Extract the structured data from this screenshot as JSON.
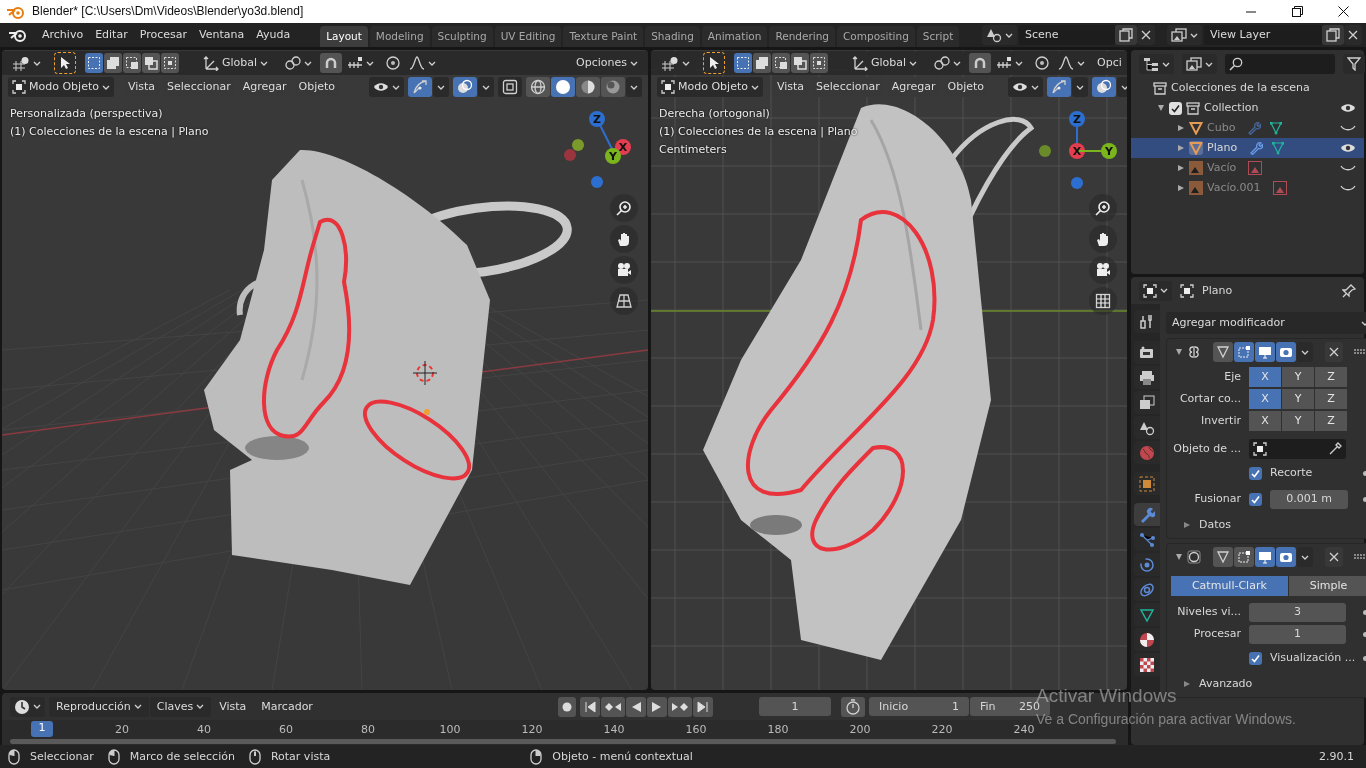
{
  "title_bar": {
    "title": "Blender* [C:\\Users\\Dm\\Videos\\Blender\\yo3d.blend]"
  },
  "menu": [
    "Archivo",
    "Editar",
    "Procesar",
    "Ventana",
    "Ayuda"
  ],
  "workspace_tabs": [
    {
      "label": "Layout",
      "selected": true
    },
    {
      "label": "Modeling",
      "selected": false
    },
    {
      "label": "Sculpting",
      "selected": false
    },
    {
      "label": "UV Editing",
      "selected": false
    },
    {
      "label": "Texture Paint",
      "selected": false
    },
    {
      "label": "Shading",
      "selected": false
    },
    {
      "label": "Animation",
      "selected": false
    },
    {
      "label": "Rendering",
      "selected": false
    },
    {
      "label": "Compositing",
      "selected": false
    },
    {
      "label": "Script",
      "selected": false
    }
  ],
  "scene": "Scene",
  "view_layer": "View Layer",
  "viewports": [
    {
      "kind": "perspective",
      "orientation": "Global",
      "options": "Opciones",
      "mode": "Modo Objeto",
      "menus": [
        "Vista",
        "Seleccionar",
        "Agregar",
        "Objeto"
      ],
      "select_modes": [
        {
          "kind": "set",
          "selected": true
        },
        {
          "kind": "extend",
          "selected": false
        },
        {
          "kind": "subtract",
          "selected": false
        },
        {
          "kind": "invert",
          "selected": false
        },
        {
          "kind": "intersect",
          "selected": false
        }
      ],
      "gizmos_on": true,
      "overlays_on": true,
      "shading": [
        {
          "kind": "wireframe",
          "selected": false
        },
        {
          "kind": "solid",
          "selected": true
        },
        {
          "kind": "material",
          "selected": false
        },
        {
          "kind": "rendered",
          "selected": false
        }
      ],
      "overlay_text": [
        "Personalizada (perspectiva)",
        "(1) Colecciones de la escena | Plano"
      ],
      "gizmo": [
        "Z",
        "X",
        "Y"
      ]
    },
    {
      "kind": "side",
      "orientation": "Global",
      "options": "Opci",
      "mode": "Modo Objeto",
      "menus": [
        "Vista",
        "Seleccionar",
        "Agregar",
        "Objeto"
      ],
      "select_modes": [
        {
          "kind": "set",
          "selected": true
        },
        {
          "kind": "extend",
          "selected": false
        },
        {
          "kind": "subtract",
          "selected": false
        },
        {
          "kind": "invert",
          "selected": false
        },
        {
          "kind": "intersect",
          "selected": false
        }
      ],
      "gizmos_on": true,
      "overlays_on": true,
      "overlay_text": [
        "Derecha (ortogonal)",
        "(1) Colecciones de la escena | Plano",
        "Centimeters"
      ],
      "gizmo": [
        "Z",
        "X",
        "Y"
      ]
    }
  ],
  "outliner": {
    "root": "Colecciones de la escena",
    "items": [
      {
        "label": "Collection",
        "kind": "collection",
        "expanded": true,
        "checked": true,
        "visible": true,
        "selected": false,
        "children": [
          {
            "label": "Cubo",
            "kind": "mesh",
            "expanded": false,
            "visible": false,
            "selected": false
          },
          {
            "label": "Plano",
            "kind": "mesh",
            "expanded": false,
            "visible": true,
            "selected": true
          },
          {
            "label": "Vacío",
            "kind": "empty",
            "expanded": false,
            "visible": false,
            "selected": false
          },
          {
            "label": "Vacío.001",
            "kind": "empty",
            "expanded": false,
            "visible": false,
            "selected": false
          }
        ]
      }
    ]
  },
  "properties": {
    "object": "Plano",
    "tabs": [
      {
        "kind": "tool",
        "selected": false
      },
      {
        "kind": "render",
        "selected": false
      },
      {
        "kind": "output",
        "selected": false
      },
      {
        "kind": "view_layer",
        "selected": false
      },
      {
        "kind": "scene",
        "selected": false
      },
      {
        "kind": "world",
        "selected": false
      },
      {
        "kind": "object",
        "selected": false
      },
      {
        "kind": "modifiers",
        "selected": true
      },
      {
        "kind": "particles",
        "selected": false
      },
      {
        "kind": "physics",
        "selected": false
      },
      {
        "kind": "constraints",
        "selected": false
      },
      {
        "kind": "data",
        "selected": false
      },
      {
        "kind": "material",
        "selected": false
      },
      {
        "kind": "texture",
        "selected": false
      }
    ],
    "add_modifier": "Agregar modificador",
    "modifiers": [
      {
        "kind": "mirror",
        "expanded": true,
        "toggles": [
          {
            "kind": "cage",
            "on": false
          },
          {
            "kind": "edit",
            "on": true
          },
          {
            "kind": "viewport",
            "on": true
          },
          {
            "kind": "render",
            "on": true
          }
        ],
        "rows": [
          {
            "kind": "axes",
            "label": "Eje",
            "buttons": [
              {
                "label": "X",
                "selected": true
              },
              {
                "label": "Y",
                "selected": false
              },
              {
                "label": "Z",
                "selected": false
              }
            ]
          },
          {
            "kind": "axes",
            "label": "Cortar co...",
            "buttons": [
              {
                "label": "X",
                "selected": true
              },
              {
                "label": "Y",
                "selected": false
              },
              {
                "label": "Z",
                "selected": false
              }
            ]
          },
          {
            "kind": "axes",
            "label": "Invertir",
            "buttons": [
              {
                "label": "X",
                "selected": false
              },
              {
                "label": "Y",
                "selected": false
              },
              {
                "label": "Z",
                "selected": false
              }
            ]
          },
          {
            "kind": "object_field",
            "label": "Objeto de ..."
          },
          {
            "kind": "checkbox",
            "label": "Recorte",
            "checked": true
          },
          {
            "kind": "checkbox_value",
            "label": "Fusionar",
            "checked": true,
            "value": "0.001 m"
          },
          {
            "kind": "subpanel",
            "label": "Datos",
            "expanded": false
          }
        ]
      },
      {
        "kind": "subdivision",
        "expanded": true,
        "toggles": [
          {
            "kind": "cage",
            "on": false
          },
          {
            "kind": "edit",
            "on": false
          },
          {
            "kind": "viewport",
            "on": true
          },
          {
            "kind": "render",
            "on": true
          }
        ],
        "rows": [
          {
            "kind": "segmented",
            "buttons": [
              {
                "label": "Catmull-Clark",
                "selected": true
              },
              {
                "label": "Simple",
                "selected": false
              }
            ]
          },
          {
            "kind": "number",
            "label": "Niveles vi...",
            "value": "3"
          },
          {
            "kind": "number",
            "label": "Procesar",
            "value": "1"
          },
          {
            "kind": "checkbox",
            "label": "Visualización ...",
            "checked": true
          },
          {
            "kind": "subpanel",
            "label": "Avanzado",
            "expanded": false
          }
        ]
      }
    ]
  },
  "timeline": {
    "menus": [
      {
        "label": "Reproducción",
        "dropdown": true
      },
      {
        "label": "Claves",
        "dropdown": true
      },
      {
        "label": "Vista",
        "dropdown": false
      },
      {
        "label": "Marcador",
        "dropdown": false
      }
    ],
    "current_frame": "1",
    "start_label": "Inicio",
    "start": "1",
    "end_label": "Fin",
    "end": "250",
    "playhead": "1",
    "ruler": [
      "20",
      "40",
      "60",
      "80",
      "100",
      "120",
      "140",
      "160",
      "180",
      "200",
      "220",
      "240"
    ]
  },
  "status_bar": {
    "hints": [
      {
        "kind": "left",
        "text": "Seleccionar"
      },
      {
        "kind": "drag",
        "text": "Marco de selección"
      },
      {
        "kind": "middle",
        "text": "Rotar vista"
      },
      {
        "kind": "right",
        "text": "Objeto - menú contextual"
      }
    ],
    "version": "2.90.1"
  },
  "os_notice": {
    "title": "Activar Windows",
    "text": "Ve a Configuración para activar Windows."
  }
}
